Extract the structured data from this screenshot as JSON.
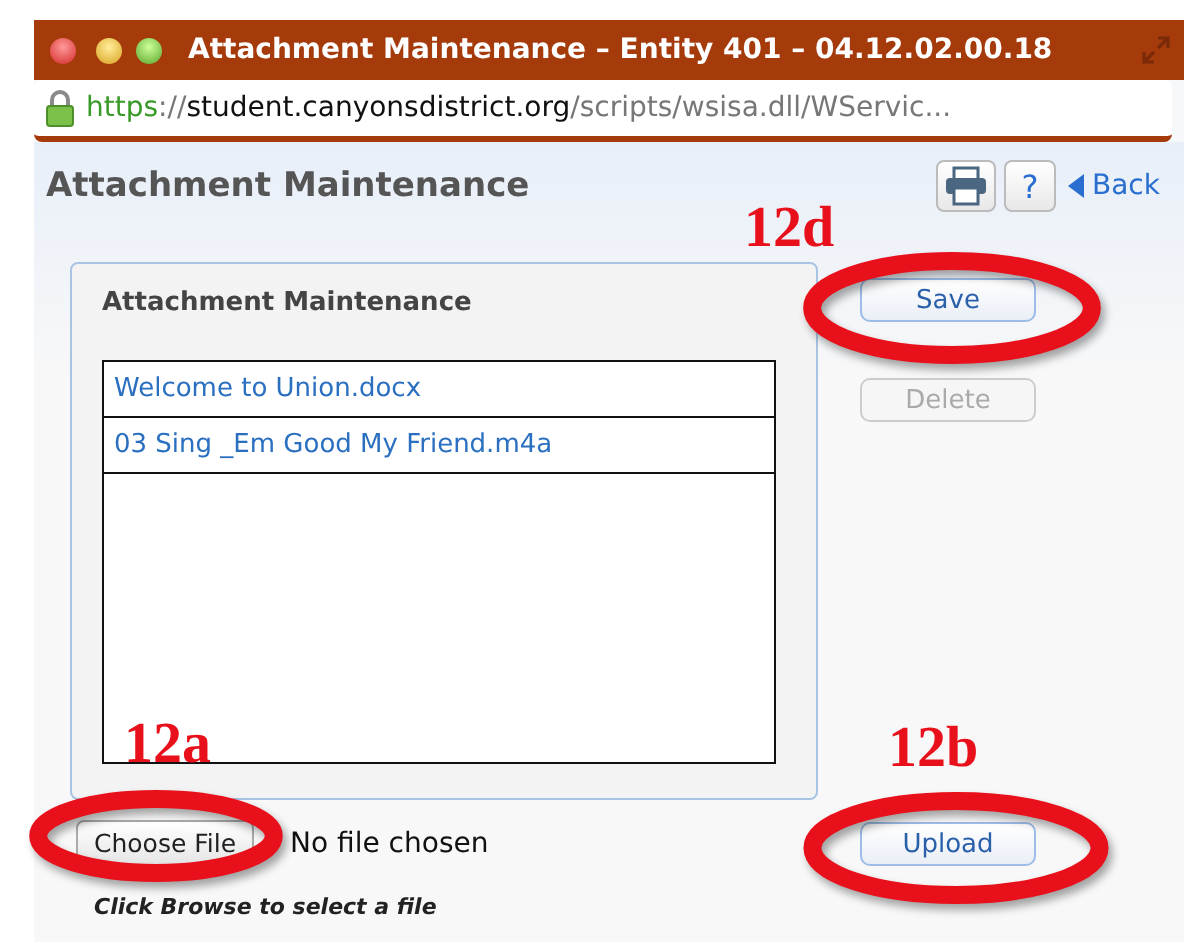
{
  "window": {
    "title": "Attachment Maintenance – Entity 401 – 04.12.02.00.18"
  },
  "address_bar": {
    "scheme": "https",
    "separator": "://",
    "host": "student.canyonsdistrict.org",
    "path": "/scripts/wsisa.dll/WServic..."
  },
  "page": {
    "title": "Attachment Maintenance",
    "toolbar": {
      "help": "?",
      "back": "Back"
    }
  },
  "panel": {
    "title": "Attachment Maintenance",
    "attachments": [
      {
        "name": "Welcome to Union.docx"
      },
      {
        "name": "03 Sing _Em Good My Friend.m4a"
      }
    ]
  },
  "buttons": [
    {
      "label": "Save",
      "disabled": false
    },
    {
      "label": "Delete",
      "disabled": true
    }
  ],
  "file_input": {
    "button": "Choose File",
    "status": "No file chosen",
    "hint": "Click Browse to select a file"
  },
  "upload": {
    "label": "Upload",
    "disabled": false
  },
  "annotations": [
    {
      "label": "12d"
    },
    {
      "label": "12a"
    },
    {
      "label": "12b"
    }
  ]
}
